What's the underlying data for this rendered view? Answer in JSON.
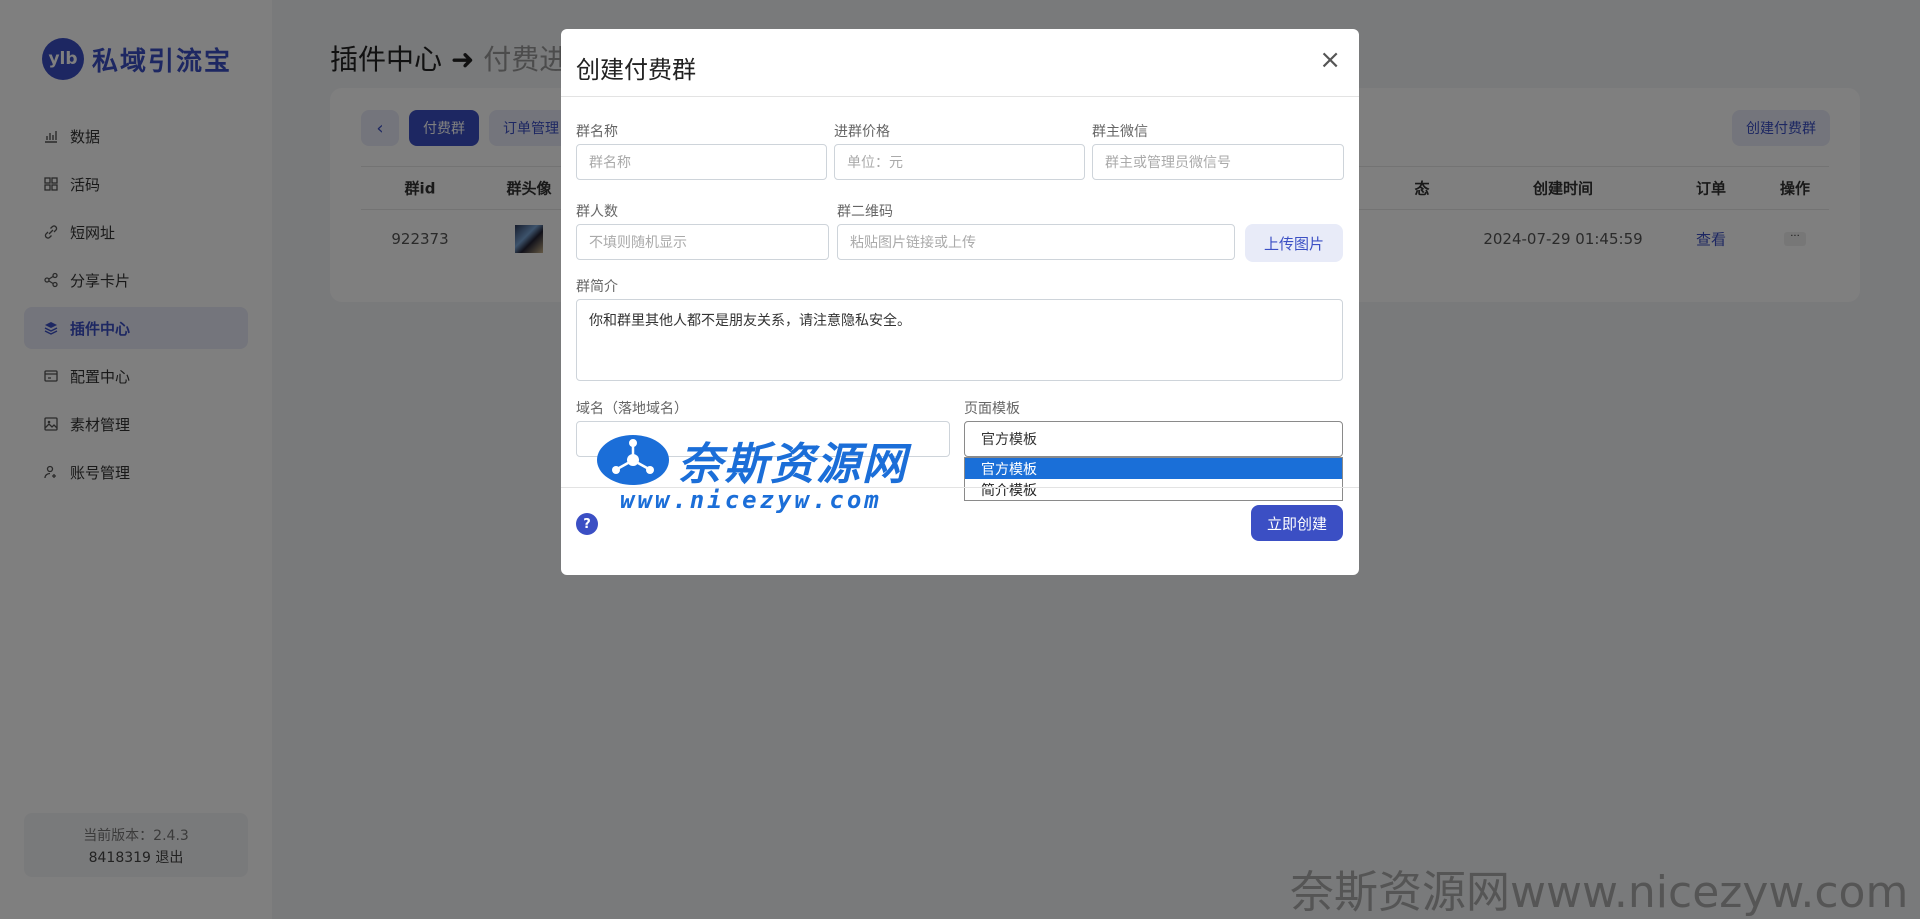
{
  "sidebar": {
    "logo_mark": "ylb",
    "logo_text": "私域引流宝",
    "items": [
      {
        "label": "数据",
        "icon": "chart-bars-icon"
      },
      {
        "label": "活码",
        "icon": "grid-icon"
      },
      {
        "label": "短网址",
        "icon": "link-icon"
      },
      {
        "label": "分享卡片",
        "icon": "share-icon"
      },
      {
        "label": "插件中心",
        "icon": "layers-icon"
      },
      {
        "label": "配置中心",
        "icon": "settings-card-icon"
      },
      {
        "label": "素材管理",
        "icon": "image-icon"
      },
      {
        "label": "账号管理",
        "icon": "user-add-icon"
      }
    ],
    "active_item": "插件中心",
    "version_line": "当前版本：2.4.3",
    "user_line": "8418319 退出"
  },
  "main": {
    "title": "插件中心",
    "arrow": "➜",
    "subtitle": "付费进",
    "toolbar": {
      "back": "‹",
      "tab_paid_group": "付费群",
      "tab_orders": "订单管理",
      "create_button": "创建付费群"
    },
    "table": {
      "headers": {
        "id": "群id",
        "avatar": "群头像",
        "status": "态",
        "created": "创建时间",
        "orders": "订单",
        "actions": "操作"
      },
      "rows": [
        {
          "id": "922373",
          "created": "2024-07-29 01:45:59",
          "orders": "查看",
          "actions": "···"
        }
      ]
    }
  },
  "modal": {
    "title": "创建付费群",
    "close": "×",
    "fields": {
      "group_name": {
        "label": "群名称",
        "placeholder": "群名称"
      },
      "price": {
        "label": "进群价格",
        "placeholder": "单位：元"
      },
      "owner_wechat": {
        "label": "群主微信",
        "placeholder": "群主或管理员微信号"
      },
      "member_count": {
        "label": "群人数",
        "placeholder": "不填则随机显示"
      },
      "qr_code": {
        "label": "群二维码",
        "placeholder": "粘贴图片链接或上传"
      },
      "upload_button": "上传图片",
      "intro": {
        "label": "群简介",
        "value": "你和群里其他人都不是朋友关系，请注意隐私安全。"
      },
      "domain": {
        "label": "域名（落地域名）"
      },
      "template": {
        "label": "页面模板",
        "selected": "官方模板",
        "options": [
          "官方模板",
          "简介模板"
        ]
      }
    },
    "help": "?",
    "submit": "立即创建"
  },
  "watermark": {
    "logo_text": "奈斯资源网",
    "url": "www.nicezyw.com",
    "corner": "奈斯资源网www.nicezyw.com"
  }
}
